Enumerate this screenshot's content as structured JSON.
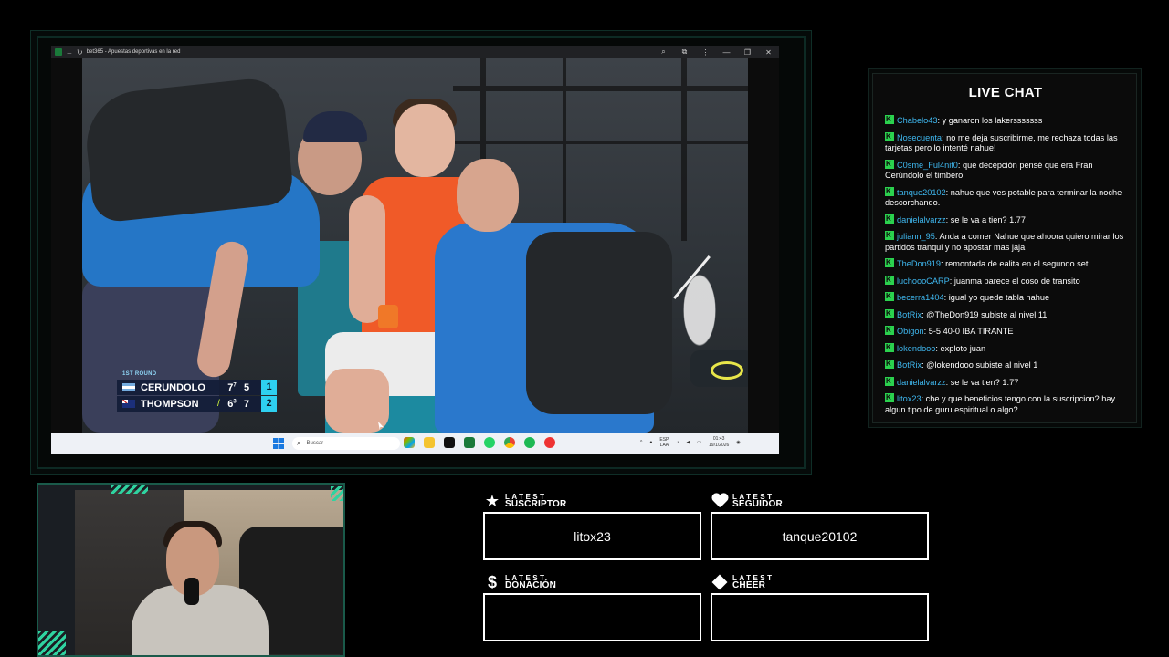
{
  "browser": {
    "title": "bet365 - Apuestas deportivas en la red",
    "controls": {
      "zoom": "⌕",
      "share": "⧉",
      "more": "⋮",
      "minimize": "—",
      "restore": "❐",
      "close": "✕"
    }
  },
  "scoreboard": {
    "round": "1ST ROUND",
    "players": [
      {
        "name": "CERUNDOLO",
        "set1": "7",
        "set1_tb": "7",
        "set2": "5",
        "current": "1",
        "flag": "argentina"
      },
      {
        "name": "THOMPSON",
        "set1": "6",
        "set1_tb": "3",
        "set2": "7",
        "current": "2",
        "flag": "australia",
        "serving": true
      }
    ]
  },
  "taskbar": {
    "search_placeholder": "Buscar",
    "lang": "ESP",
    "lang2": "LAA",
    "time": "01:43",
    "date": "19/1/2026"
  },
  "chat": {
    "title": "LIVE CHAT",
    "messages": [
      {
        "user": "Chabelo43",
        "text": "y ganaron los lakersssssss"
      },
      {
        "user": "Nosecuenta",
        "text": "no me deja suscribirme, me rechaza todas las tarjetas pero lo intenté nahue!"
      },
      {
        "user": "C0sme_Ful4nit0",
        "text": "que decepción pensé que era Fran Cerúndolo el timbero"
      },
      {
        "user": "tanque20102",
        "text": "nahue que ves potable para terminar la noche descorchando."
      },
      {
        "user": "danielalvarzz",
        "text": "se le va a tien? 1.77"
      },
      {
        "user": "juliann_95",
        "text": "Anda a comer Nahue que ahoora quiero mirar los partidos tranqui y no apostar mas jaja"
      },
      {
        "user": "TheDon919",
        "text": "remontada de ealita en el segundo set"
      },
      {
        "user": "luchoooCARP",
        "text": "juanma parece el coso de transito"
      },
      {
        "user": "becerra1404",
        "text": "igual yo quede tabla nahue"
      },
      {
        "user": "BotRix",
        "text": "@TheDon919 subiste al nivel 11"
      },
      {
        "user": "Obigon",
        "text": "5-5 40-0 IBA TIRANTE"
      },
      {
        "user": "lokendooo",
        "text": "exploto juan"
      },
      {
        "user": "BotRix",
        "text": "@lokendooo subiste al nivel 1"
      },
      {
        "user": "danielalvarzz",
        "text": "se le va tien? 1.77"
      },
      {
        "user": "litox23",
        "text": "che y que beneficios tengo con la suscripcion? hay algun tipo de guru espiritual o algo?"
      }
    ]
  },
  "widgets": {
    "suscriptor": {
      "small": "LATEST",
      "big": "SUSCRIPTOR",
      "value": "litox23",
      "icon": "star-icon"
    },
    "seguidor": {
      "small": "LATEST",
      "big": "SEGUIDOR",
      "value": "tanque20102",
      "icon": "heart-icon"
    },
    "donacion": {
      "small": "LATEST",
      "big": "DONACIÓN",
      "value": "",
      "icon": "dollar-icon"
    },
    "cheer": {
      "small": "LATEST",
      "big": "CHEER",
      "value": "",
      "icon": "diamond-icon"
    }
  },
  "colors": {
    "accent": "#2bd14e",
    "username": "#3fb8f0",
    "score_highlight": "#2ed0f0",
    "frame": "#1a5a4a"
  }
}
